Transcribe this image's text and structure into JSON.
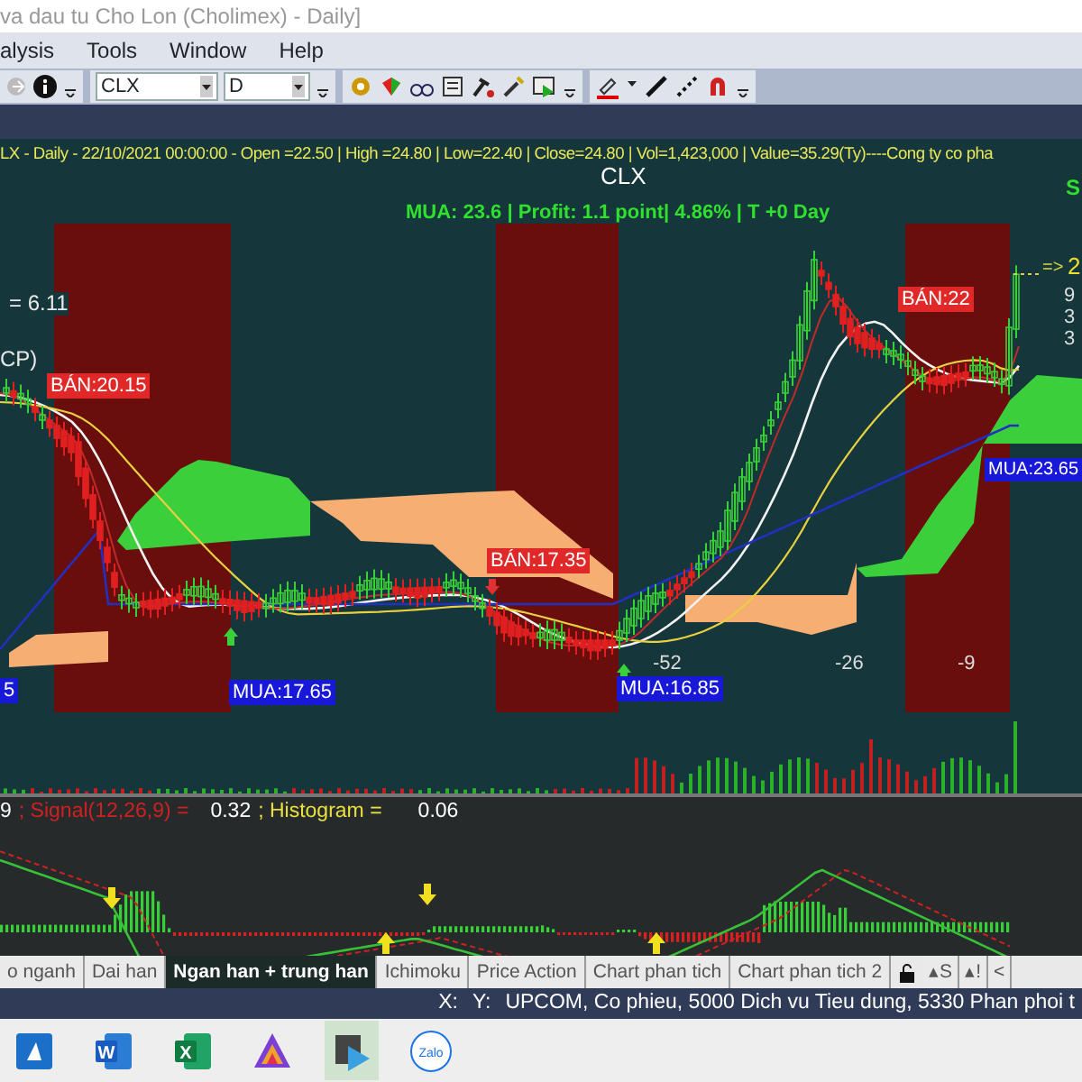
{
  "window": {
    "title": "va dau tu Cho Lon (Cholimex) - Daily]"
  },
  "menu": [
    "alysis",
    "Tools",
    "Window",
    "Help"
  ],
  "toolbar": {
    "symbol": "CLX",
    "period": "D"
  },
  "chart": {
    "info_line": "LX - Daily  - 22/10/2021 00:00:00 -  Open =22.50 | High =24.80 | Low=22.40 | Close=24.80 | Vol=1,423,000 | Value=35.29(Ty)----Cong ty co pha",
    "title": "CLX",
    "summary": "MUA:  23.6  | Profit: 1.1 point| 4.86% | T +0 Day",
    "corner_label": "S",
    "left_texts": [
      "= 6.11",
      "CP)"
    ],
    "signals": [
      {
        "kind": "sell",
        "text": "BÁN:20.15"
      },
      {
        "kind": "buy",
        "text": "5"
      },
      {
        "kind": "buy",
        "text": "MUA:17.65"
      },
      {
        "kind": "sell",
        "text": "BÁN:17.35"
      },
      {
        "kind": "buy",
        "text": "MUA:16.85"
      },
      {
        "kind": "sell",
        "text": "BÁN:22"
      },
      {
        "kind": "buy",
        "text": "MUA:23.65"
      }
    ],
    "counters": [
      "-52",
      "-26",
      "-9"
    ],
    "price_arrow": "=>",
    "right_values": [
      "2",
      "9",
      "3",
      "3"
    ]
  },
  "macd": {
    "lead": "9",
    "signal_label": "; Signal(12,26,9) =",
    "signal_value": "0.32",
    "histogram_label": "; Histogram =",
    "histogram_value": "0.06"
  },
  "tabs": [
    {
      "label": "o nganh",
      "selected": false
    },
    {
      "label": "Dai han",
      "selected": false
    },
    {
      "label": "Ngan han + trung han",
      "selected": true
    },
    {
      "label": "Ichimoku",
      "selected": false
    },
    {
      "label": "Price Action",
      "selected": false
    },
    {
      "label": "Chart phan tich",
      "selected": false
    },
    {
      "label": "Chart phan tich 2",
      "selected": false
    }
  ],
  "tab_buttons": [
    "▴S",
    "▴!",
    "<"
  ],
  "status_bar": {
    "x_label": "X:",
    "y_label": "Y:",
    "info": "UPCOM, Co phieu, 5000 Dich vu Tieu dung, 5330 Phan phoi t"
  },
  "taskbar": [
    {
      "kind": "edu",
      "selected": false
    },
    {
      "kind": "word",
      "glyph": "W",
      "selected": false
    },
    {
      "kind": "excel",
      "glyph": "X",
      "selected": false
    },
    {
      "kind": "prism",
      "selected": false
    },
    {
      "kind": "media",
      "selected": true
    },
    {
      "kind": "chat",
      "glyph": "Zalo",
      "selected": false
    }
  ]
}
